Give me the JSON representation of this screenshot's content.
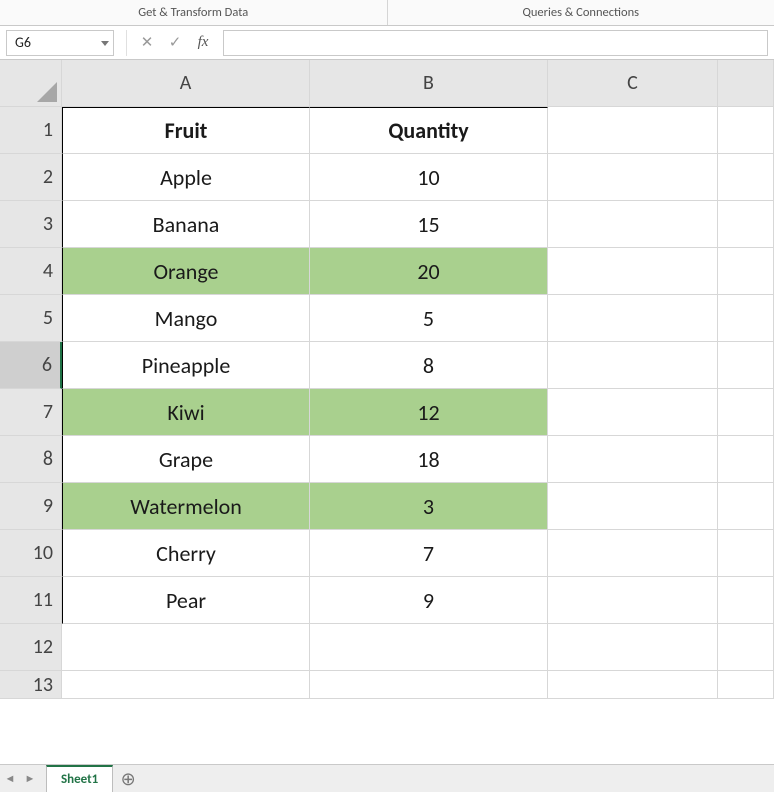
{
  "ribbon": {
    "group_left": "Get & Transform Data",
    "group_right": "Queries & Connections"
  },
  "formula_bar": {
    "cell_ref": "G6",
    "cancel": "✕",
    "enter": "✓",
    "fx": "fx",
    "value": ""
  },
  "columns": [
    "A",
    "B",
    "C"
  ],
  "row_numbers": [
    "1",
    "2",
    "3",
    "4",
    "5",
    "6",
    "7",
    "8",
    "9",
    "10",
    "11",
    "12",
    "13"
  ],
  "active_row": "6",
  "table": {
    "headers": [
      "Fruit",
      "Quantity"
    ],
    "rows": [
      {
        "fruit": "Apple",
        "qty": "10",
        "highlight": false
      },
      {
        "fruit": "Banana",
        "qty": "15",
        "highlight": false
      },
      {
        "fruit": "Orange",
        "qty": "20",
        "highlight": true
      },
      {
        "fruit": "Mango",
        "qty": "5",
        "highlight": false
      },
      {
        "fruit": "Pineapple",
        "qty": "8",
        "highlight": false
      },
      {
        "fruit": "Kiwi",
        "qty": "12",
        "highlight": true
      },
      {
        "fruit": "Grape",
        "qty": "18",
        "highlight": false
      },
      {
        "fruit": "Watermelon",
        "qty": "3",
        "highlight": true
      },
      {
        "fruit": "Cherry",
        "qty": "7",
        "highlight": false
      },
      {
        "fruit": "Pear",
        "qty": "9",
        "highlight": false
      }
    ]
  },
  "colors": {
    "highlight": "#a9d08e",
    "excel_green": "#217346"
  },
  "tabs": {
    "active": "Sheet1",
    "add_label": "⊕",
    "nav_prev": "◄",
    "nav_next": "►"
  }
}
